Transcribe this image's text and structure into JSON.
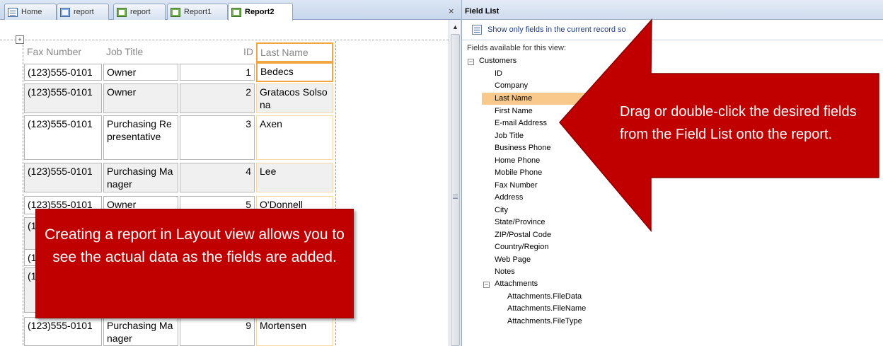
{
  "tabs": [
    {
      "label": "Home",
      "icon": "form-list-icon"
    },
    {
      "label": "report",
      "icon": "form-icon"
    },
    {
      "label": "report",
      "icon": "report-icon"
    },
    {
      "label": "Report1",
      "icon": "report-icon"
    },
    {
      "label": "Report2",
      "icon": "report-icon",
      "active": true
    }
  ],
  "tab_close": "×",
  "report": {
    "headers": {
      "fax": "Fax Number",
      "job": "Job Title",
      "id": "ID",
      "last": "Last Name"
    },
    "rows": [
      {
        "fax": "(123)555-0101",
        "job": "Owner",
        "id": "1",
        "last": "Bedecs"
      },
      {
        "fax": "(123)555-0101",
        "job": "Owner",
        "id": "2",
        "last": "Gratacos Solsona"
      },
      {
        "fax": "(123)555-0101",
        "job": "Purchasing Representative",
        "id": "3",
        "last": "Axen"
      },
      {
        "fax": "(123)555-0101",
        "job": "Purchasing Manager",
        "id": "4",
        "last": "Lee"
      },
      {
        "fax": "(123)555-0101",
        "job": "Owner",
        "id": "5",
        "last": "O'Donnell"
      },
      {
        "fax": "(1",
        "job": "",
        "id": "",
        "last": ""
      },
      {
        "fax": "(1",
        "job": "",
        "id": "",
        "last": ""
      },
      {
        "fax": "(1",
        "job": "",
        "id": "",
        "last": ""
      },
      {
        "fax": "(123)555-0101",
        "job": "Purchasing Manager",
        "id": "9",
        "last": "Mortensen"
      }
    ]
  },
  "field_list": {
    "title": "Field List",
    "show_only": "Show only fields in the current record so",
    "available": "Fields available for this view:",
    "customers": {
      "label": "Customers",
      "expander": "−",
      "fields": [
        "ID",
        "Company",
        "Last Name",
        "First Name",
        "E-mail Address",
        "Job Title",
        "Business Phone",
        "Home Phone",
        "Mobile Phone",
        "Fax Number",
        "Address",
        "City",
        "State/Province",
        "ZIP/Postal Code",
        "Country/Region",
        "Web Page",
        "Notes"
      ],
      "highlighted": "Last Name"
    },
    "attachments": {
      "label": "Attachments",
      "expander": "−",
      "fields": [
        "Attachments.FileData",
        "Attachments.FileName",
        "Attachments.FileType"
      ]
    }
  },
  "callouts": {
    "right": "Drag or double-click the desired fields from the Field List onto the report.",
    "left": "Creating a report in Layout view allows you to see the actual data as the fields are added."
  },
  "colors": {
    "callout": "#c00000",
    "highlight": "#f8c98b",
    "selection": "#f2a540"
  }
}
